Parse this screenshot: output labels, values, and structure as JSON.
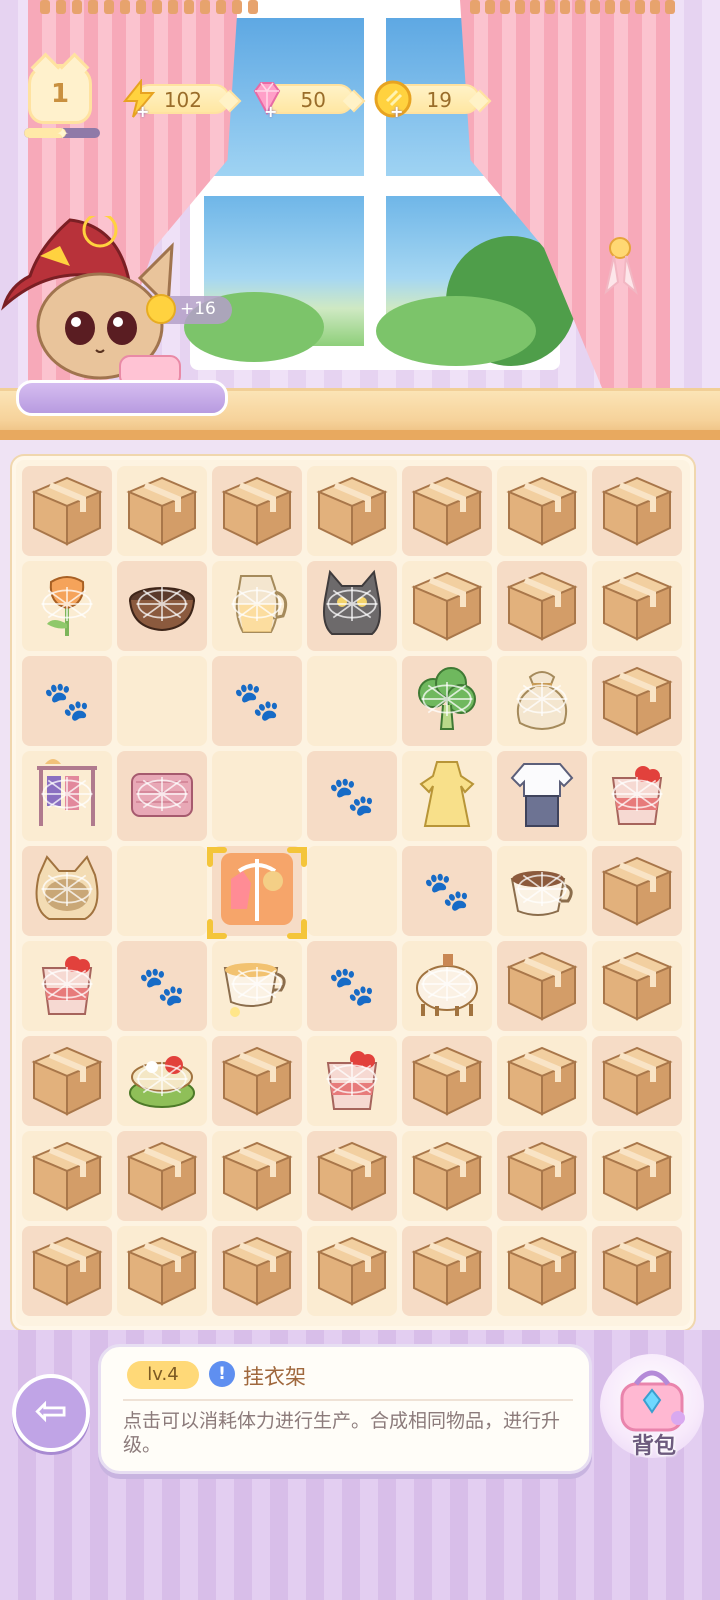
{
  "hud": {
    "level": "1",
    "xp_progress": 0.55,
    "energy": "102",
    "gems": "50",
    "coins": "19",
    "icons": {
      "energy": "lightning-bolt-icon",
      "gems": "pink-diamond-icon",
      "coins": "gold-coin-icon",
      "add": "plus-icon"
    }
  },
  "character": {
    "reward": "+16",
    "name": ""
  },
  "board": {
    "rows": 9,
    "cols": 7,
    "grid": [
      [
        "box",
        "box",
        "box",
        "box",
        "box",
        "box",
        "box"
      ],
      [
        "tulip",
        "bowl",
        "pitcher",
        "grey-cat",
        "box",
        "box",
        "box"
      ],
      [
        "paw",
        "empty",
        "paw",
        "empty",
        "broccoli",
        "sack",
        "box"
      ],
      [
        "clothes-rack",
        "sweater",
        "empty",
        "paw",
        "yellow-dress",
        "blouse",
        "parfait"
      ],
      [
        "cat-bed",
        "empty",
        "selected-hanger",
        "empty",
        "paw",
        "coffee-cup",
        "box"
      ],
      [
        "parfait",
        "paw",
        "tea-cup",
        "paw",
        "piggy",
        "box",
        "box"
      ],
      [
        "box",
        "cake",
        "box",
        "parfait",
        "box",
        "box",
        "box"
      ],
      [
        "box",
        "box",
        "box",
        "box",
        "box",
        "box",
        "box"
      ],
      [
        "box",
        "box",
        "box",
        "box",
        "box",
        "box",
        "box"
      ]
    ],
    "webbed": [
      "tulip",
      "bowl",
      "pitcher",
      "grey-cat",
      "broccoli",
      "sack",
      "clothes-rack",
      "sweater",
      "parfait",
      "cat-bed",
      "coffee-cup",
      "tea-cup",
      "piggy",
      "cake"
    ]
  },
  "info": {
    "level_tag": "lv.4",
    "item_name": "挂衣架",
    "description": "点击可以消耗体力进行生产。合成相同物品，进行升级。"
  },
  "buttons": {
    "back": "back-arrow-icon",
    "bag_label": "背包"
  },
  "colors": {
    "accent_purple": "#c0a4e6",
    "level_gold": "#ffd978",
    "info_blue": "#5f8ff0"
  }
}
